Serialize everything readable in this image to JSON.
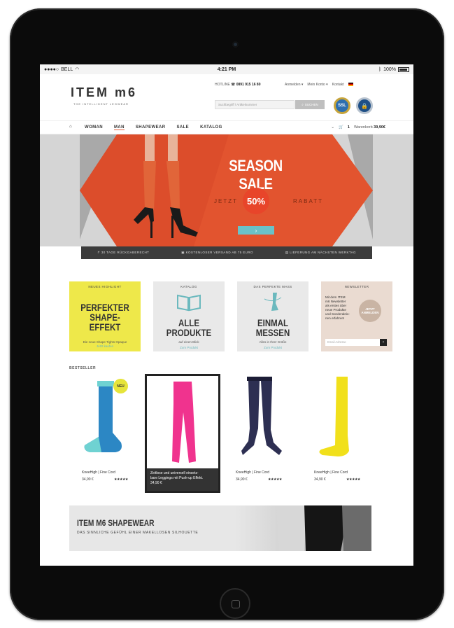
{
  "status": {
    "carrier": "BELL",
    "time": "4:21 PM",
    "battery": "100%"
  },
  "header": {
    "logo": "ITEM m6",
    "tagline": "THE INTELLIGENT LEGWEAR",
    "hotline_label": "HOTLINE",
    "hotline_number": "0891 915 16 80",
    "links": [
      "Anmelden",
      "Mein Konto",
      "Kontakt"
    ],
    "search_placeholder": "Suchbegriff / Artikelnummer",
    "search_button": "SUCHEN",
    "badge_ssl": "SSL",
    "badge_trust": "🔒"
  },
  "nav": {
    "items": [
      "WOMAN",
      "MAN",
      "SHAPEWEAR",
      "SALE",
      "KATALOG"
    ],
    "cart_count": "1",
    "cart_label": "Warenkorb",
    "cart_total": "39,90€"
  },
  "hero": {
    "title": "SEASON SALE",
    "jetzt": "JETZT",
    "percent": "50%",
    "rabatt": "RABATT",
    "button": "›"
  },
  "usp": [
    "30 TAGE RÜCKGABERECHT",
    "KOSTENLOSER VERSAND AB 75 EURO",
    "LIEFERUNG AM NÄCHSTEN WERKTAG"
  ],
  "tiles": [
    {
      "top": "NEUES HIGHLIGHT",
      "big1": "PERFEKTER",
      "big2": "SHAPE-EFFEKT",
      "sub": "Die neue Shape Tights Opaque",
      "link": "Jetzt kaufen"
    },
    {
      "top": "KATALOG",
      "big": "ALLE PRODUKTE",
      "sub": "auf einen Blick",
      "link": "Zum Produkt"
    },
    {
      "top": "DAS PERFEKTE MASS",
      "big": "EINMAL MESSEN",
      "sub": "Alles in Ihrer Größe",
      "link": "Zum Produkt"
    },
    {
      "top": "NEWSLETTER",
      "text": [
        "Mit dem ITEM",
        "m6 Newsletter",
        "als erstes über",
        "neue Produkte",
        "und Sonderaktio-",
        "nen erfahren!"
      ],
      "circle1": "JETZT",
      "circle2": "ANMELDEN",
      "placeholder": "Email Adresse",
      "button": "›"
    }
  ],
  "bestseller_title": "BESTSELLER",
  "products": [
    {
      "name": "KneeHigh | Fine Cord",
      "price": "34,90 €",
      "stars": "★★★★★",
      "badge": "NEU",
      "color": "#2c87c4"
    },
    {
      "hl_text": [
        "Zeitlose und universell einsetz-",
        "bare Leggings mit Push-up Effekt."
      ],
      "price": "34,90 €",
      "color": "#f0338e"
    },
    {
      "name": "KneeHigh | Fine Cord",
      "price": "34,90 €",
      "stars": "★★★★★",
      "color": "#2d2f52"
    },
    {
      "name": "KneeHigh | Fine Cord",
      "price": "34,90 €",
      "stars": "★★★★★",
      "color": "#f1e01b"
    }
  ],
  "shapewear": {
    "title": "ITEM M6 SHAPEWEAR",
    "subtitle": "DAS SINNLICHE GEFÜHL EINER MAKELLOSEN SILHOUETTE"
  },
  "colors": {
    "accent": "#e8452a",
    "teal": "#6ac2c8",
    "yellow": "#eee84a"
  }
}
